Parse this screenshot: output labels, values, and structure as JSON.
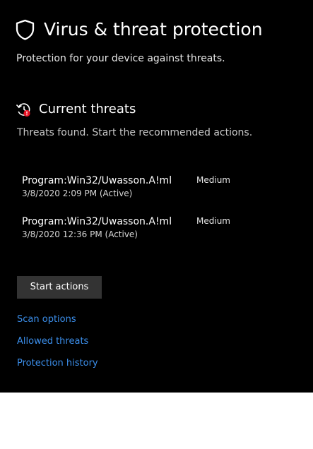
{
  "header": {
    "icon": "shield-icon",
    "title": "Virus & threat protection",
    "subtitle": "Protection for your device against threats."
  },
  "current_threats": {
    "icon": "history-alert-icon",
    "title": "Current threats",
    "description": "Threats found. Start the recommended actions.",
    "items": [
      {
        "name": "Program:Win32/Uwasson.A!ml",
        "date": "3/8/2020 2:09 PM (Active)",
        "severity": "Medium"
      },
      {
        "name": "Program:Win32/Uwasson.A!ml",
        "date": "3/8/2020 12:36 PM (Active)",
        "severity": "Medium"
      }
    ]
  },
  "actions": {
    "start_label": "Start actions"
  },
  "links": {
    "scan_options": "Scan options",
    "allowed_threats": "Allowed threats",
    "protection_history": "Protection history"
  },
  "colors": {
    "background": "#000000",
    "link": "#3b8eea",
    "button": "#333333",
    "alert": "#e81123"
  }
}
